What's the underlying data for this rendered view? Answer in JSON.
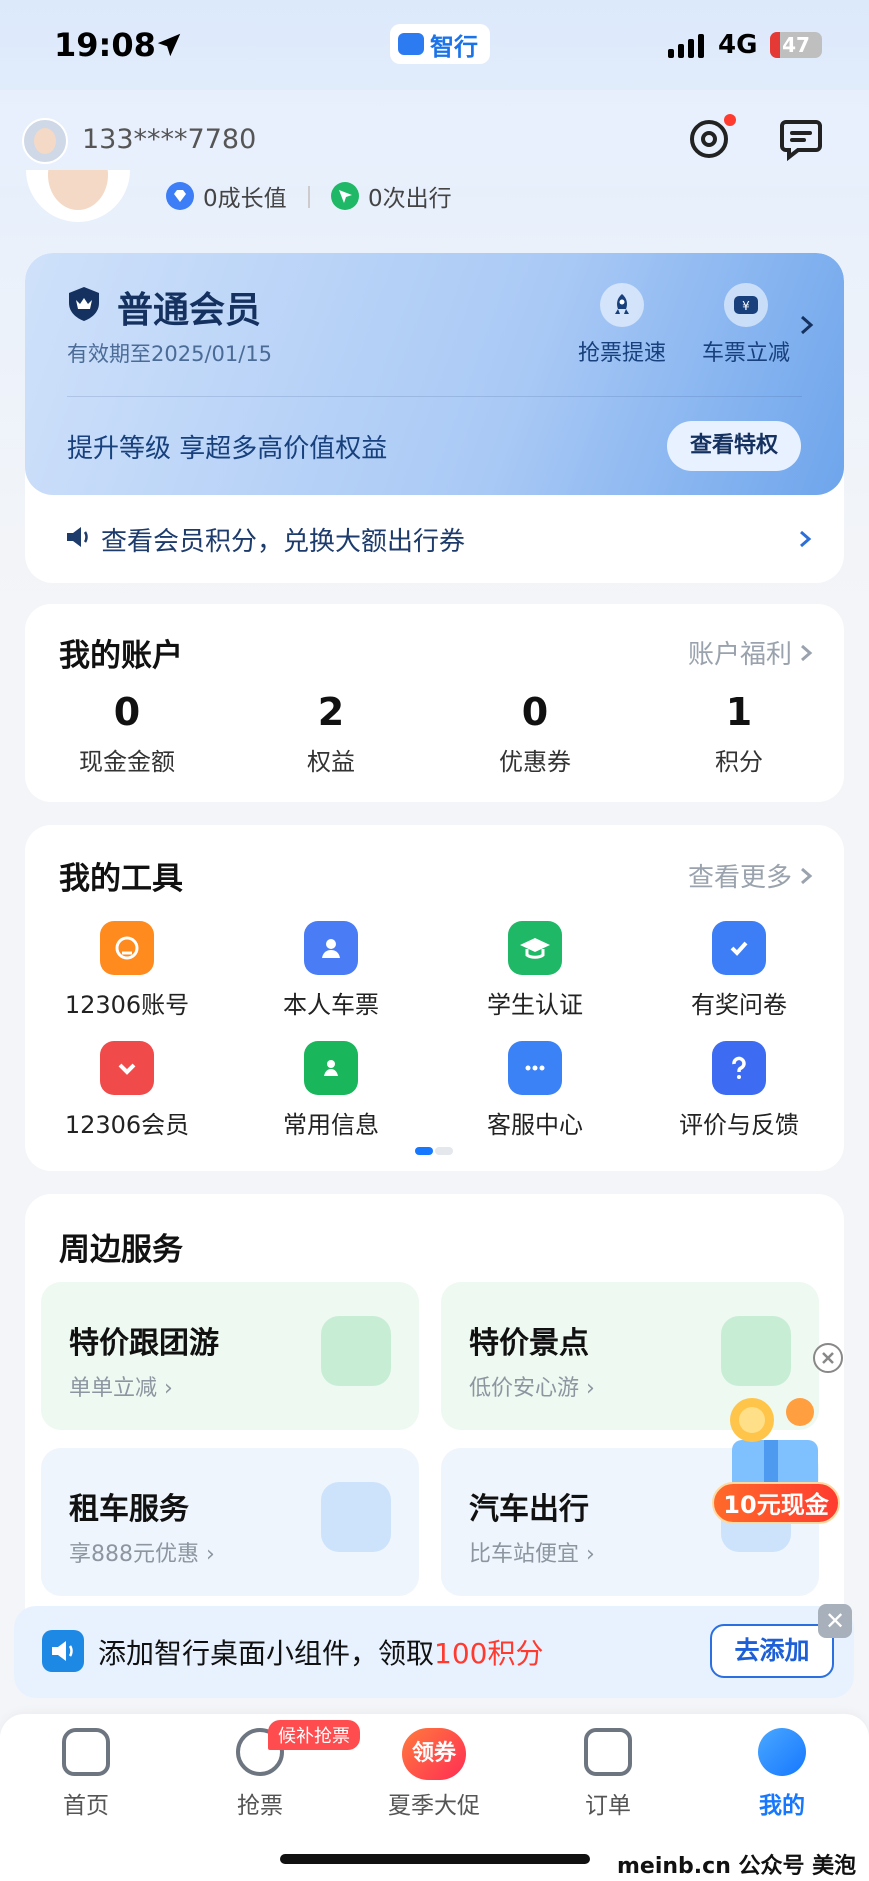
{
  "status_bar": {
    "time": "19:08",
    "network": "4G",
    "battery": "47",
    "app_label": "智行"
  },
  "header": {
    "phone": "133****7780"
  },
  "profile": {
    "growth": "0成长值",
    "trips": "0次出行"
  },
  "member": {
    "title": "普通会员",
    "valid": "有效期至2025/01/15",
    "perks": [
      "抢票提速",
      "车票立减"
    ],
    "promo": "提升等级 享超多高价值权益",
    "button": "查看特权",
    "points_text": "查看会员积分，兑换大额出行券"
  },
  "account": {
    "title": "我的账户",
    "more": "账户福利",
    "items": [
      {
        "value": "0",
        "label": "现金金额"
      },
      {
        "value": "2",
        "label": "权益"
      },
      {
        "value": "0",
        "label": "优惠券"
      },
      {
        "value": "1",
        "label": "积分"
      }
    ]
  },
  "tools": {
    "title": "我的工具",
    "more": "查看更多",
    "items": [
      {
        "label": "12306账号",
        "icon": "railway-account-icon",
        "color": "#ff8a1e"
      },
      {
        "label": "本人车票",
        "icon": "ticket-person-icon",
        "color": "#4a7cf6"
      },
      {
        "label": "学生认证",
        "icon": "graduation-cap-icon",
        "color": "#1fb866"
      },
      {
        "label": "有奖问卷",
        "icon": "survey-check-icon",
        "color": "#3d7ef7"
      },
      {
        "label": "12306会员",
        "icon": "member-heart-icon",
        "color": "#f04a4a"
      },
      {
        "label": "常用信息",
        "icon": "contact-info-icon",
        "color": "#19b65c"
      },
      {
        "label": "客服中心",
        "icon": "chat-bubble-icon",
        "color": "#3b82f6"
      },
      {
        "label": "评价与反馈",
        "icon": "question-mark-icon",
        "color": "#3d6cf2"
      }
    ]
  },
  "services": {
    "title": "周边服务",
    "items": [
      {
        "title": "特价跟团游",
        "sub": "单单立减",
        "bg": "#eef9f1",
        "art": "#7fd9a0"
      },
      {
        "title": "特价景点",
        "sub": "低价安心游",
        "bg": "#eef9f1",
        "art": "#7fd9a0"
      },
      {
        "title": "租车服务",
        "sub": "享888元优惠",
        "bg": "#eef5fd",
        "art": "#8ec3f5"
      },
      {
        "title": "汽车出行",
        "sub": "比车站便宜",
        "bg": "#eef5fd",
        "art": "#8ec3f5"
      }
    ]
  },
  "float_coupon": {
    "label": "10元现金"
  },
  "widget_banner": {
    "text_pre": "添加智行桌面小组件，领取",
    "text_hl": "100积分",
    "button": "去添加"
  },
  "tabbar": {
    "badge": "候补抢票",
    "tabs": [
      {
        "label": "首页"
      },
      {
        "label": "抢票"
      },
      {
        "label": "夏季大促",
        "promo": "领券"
      },
      {
        "label": "订单"
      },
      {
        "label": "我的"
      }
    ]
  },
  "watermark": "meinb.cn  公众号 美泡君",
  "colors": {
    "accent": "#1677ff",
    "alert": "#ff3b30"
  }
}
